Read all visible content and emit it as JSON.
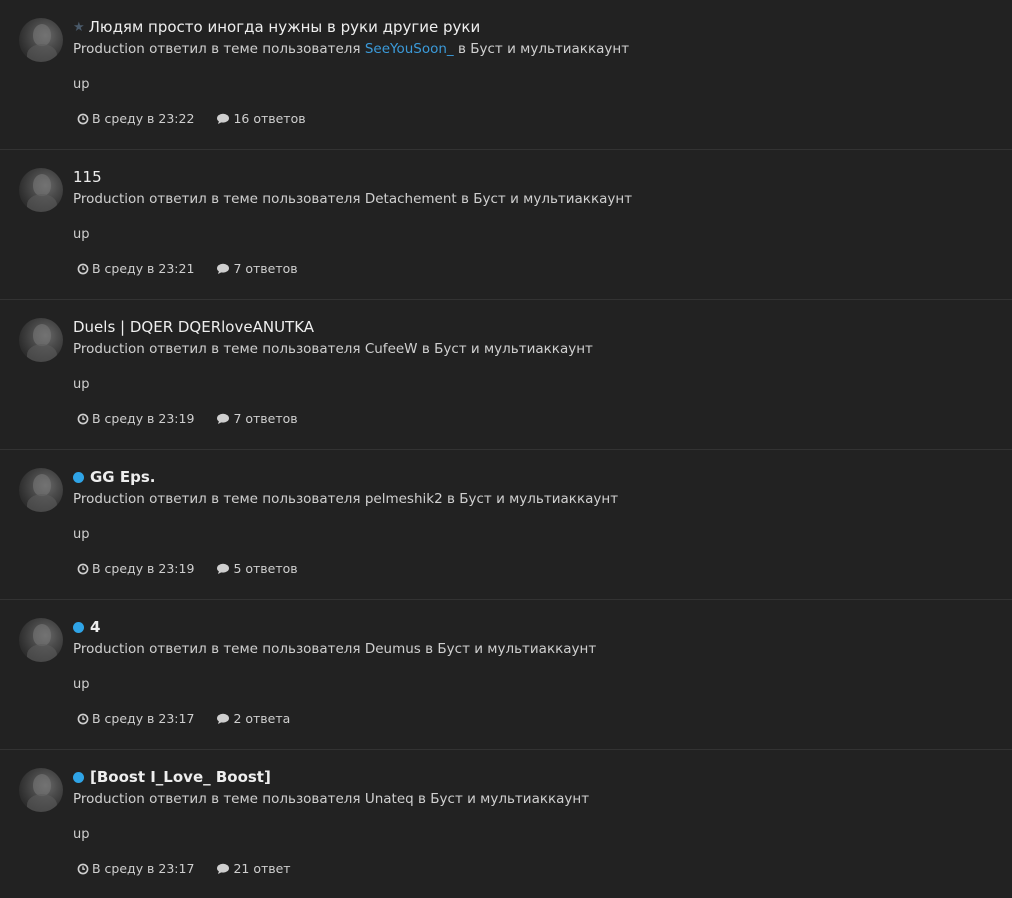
{
  "colors": {
    "background": "#222222",
    "divider": "#333333",
    "unread_dot": "#2fa4e7",
    "link_blue": "#3b9ad9",
    "star": "#4a5a6a"
  },
  "entries": [
    {
      "marker": "star-icon",
      "title": "Людям просто иногда нужны в руки другие руки",
      "bold": false,
      "author": "Production",
      "action": "ответил в теме пользователя",
      "topic_author": "SeeYouSoon_",
      "topic_author_highlight": true,
      "in_label": "в",
      "forum": "Буст и мультиаккаунт",
      "snippet": "up",
      "time": "В среду в 23:22",
      "replies": "16 ответов"
    },
    {
      "marker": "none",
      "title": "115",
      "bold": false,
      "author": "Production",
      "action": "ответил в теме пользователя",
      "topic_author": "Detachement",
      "topic_author_highlight": false,
      "in_label": "в",
      "forum": "Буст и мультиаккаунт",
      "snippet": "up",
      "time": "В среду в 23:21",
      "replies": "7 ответов"
    },
    {
      "marker": "none",
      "title": "Duels | DQER DQERloveANUTKA",
      "bold": false,
      "author": "Production",
      "action": "ответил в теме пользователя",
      "topic_author": "CufeeW",
      "topic_author_highlight": false,
      "in_label": "в",
      "forum": "Буст и мультиаккаунт",
      "snippet": "up",
      "time": "В среду в 23:19",
      "replies": "7 ответов"
    },
    {
      "marker": "unread-dot-icon",
      "title": "GG Eps.",
      "bold": true,
      "author": "Production",
      "action": "ответил в теме пользователя",
      "topic_author": "pelmeshik2",
      "topic_author_highlight": false,
      "in_label": "в",
      "forum": "Буст и мультиаккаунт",
      "snippet": "up",
      "time": "В среду в 23:19",
      "replies": "5 ответов"
    },
    {
      "marker": "unread-dot-icon",
      "title": "4",
      "bold": true,
      "author": "Production",
      "action": "ответил в теме пользователя",
      "topic_author": "Deumus",
      "topic_author_highlight": false,
      "in_label": "в",
      "forum": "Буст и мультиаккаунт",
      "snippet": "up",
      "time": "В среду в 23:17",
      "replies": "2 ответа"
    },
    {
      "marker": "unread-dot-icon",
      "title": "[Boost I_Love_ Boost]",
      "bold": true,
      "author": "Production",
      "action": "ответил в теме пользователя",
      "topic_author": "Unateq",
      "topic_author_highlight": false,
      "in_label": "в",
      "forum": "Буст и мультиаккаунт",
      "snippet": "up",
      "time": "В среду в 23:17",
      "replies": "21 ответ"
    }
  ]
}
